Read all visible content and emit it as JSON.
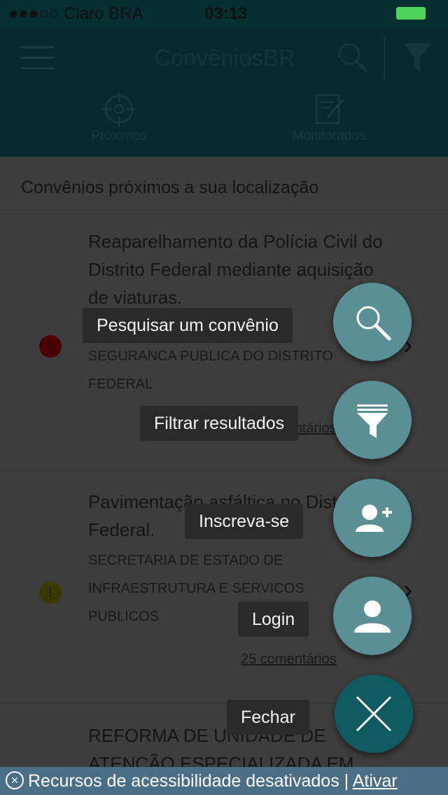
{
  "status_bar": {
    "carrier": "●●●○○ Claro BRA",
    "time": "03:13"
  },
  "header": {
    "title": "ConvêniosBR"
  },
  "tabs": [
    {
      "label": "Próximos"
    },
    {
      "label": "Monitorados"
    }
  ],
  "section_title": "Convênios próximos a sua localização",
  "cards": [
    {
      "name": "Reaparelhamento da Polícia Civil do Distrito Federal mediante aquisição de viaturas.",
      "org": "SECRETARIA DE ESTADO DE SEGURANCA PUBLICA DO DISTRITO FEDERAL",
      "comments": "25 comentários"
    },
    {
      "name": "Pavimentação asfáltica no Distrito Federal.",
      "org": "SECRETARIA DE ESTADO DE INFRAESTRUTURA E SERVICOS PUBLICOS",
      "comments": "25 comentários"
    },
    {
      "name": "REFORMA DE UNIDADE DE ATENÇÃO ESPECIALIZADA EM"
    }
  ],
  "fab_menu": {
    "search_label": "Pesquisar um convênio",
    "filter_label": "Filtrar resultados",
    "signup_label": "Inscreva-se",
    "login_label": "Login",
    "close_label": "Fechar"
  },
  "accessibility": {
    "text": "Recursos de acessibilidade desativados |",
    "link": "Ativar"
  }
}
